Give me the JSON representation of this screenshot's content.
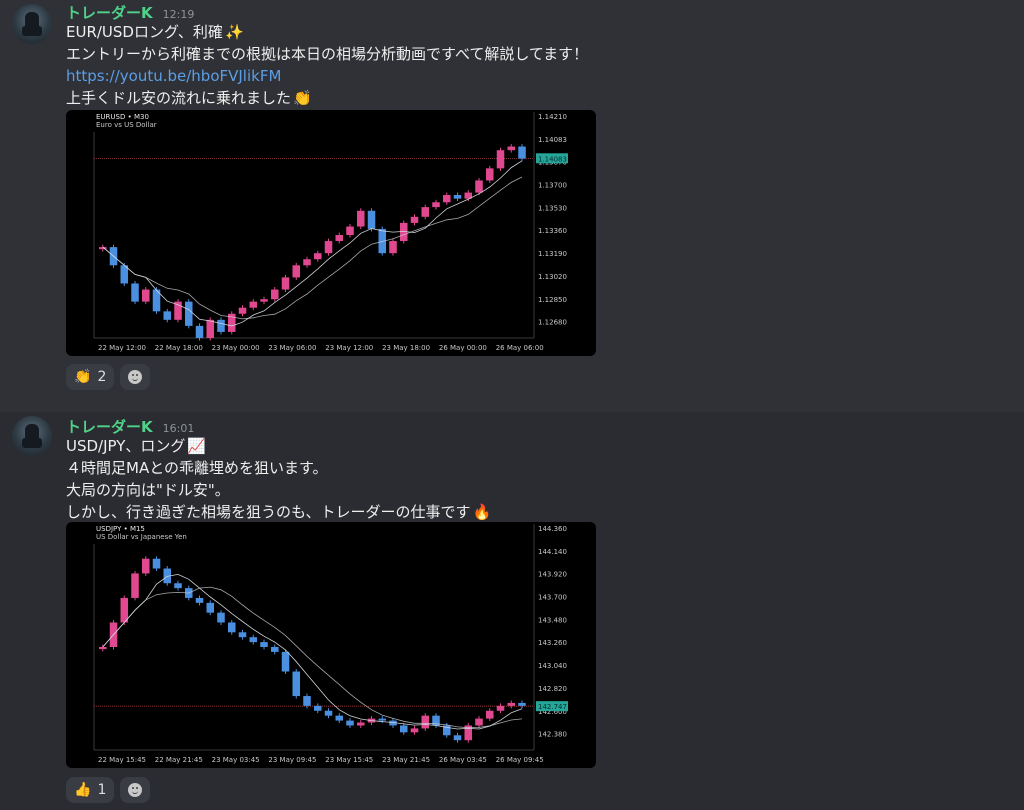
{
  "messages": [
    {
      "username": "トレーダーK",
      "time": "12:19",
      "lines": [
        "EUR/USDロング、利確",
        "エントリーから利確までの根拠は本日の相場分析動画ですべて解説してます！",
        "https://youtu.be/hboFVJlikFM",
        "上手くドル安の流れに乗れました"
      ],
      "line1_emoji": "✨",
      "line4_emoji": "👏",
      "reactions": [
        {
          "emoji": "👏",
          "count": "2"
        }
      ]
    },
    {
      "username": "トレーダーK",
      "time": "16:01",
      "lines": [
        "USD/JPY、ロング",
        "４時間足MAとの乖離埋めを狙います。",
        "大局の方向は\"ドル安\"。",
        "しかし、行き過ぎた相場を狙うのも、トレーダーの仕事です"
      ],
      "line1_emoji": "📈",
      "line4_emoji": "🔥",
      "reactions": [
        {
          "emoji": "👍",
          "count": "1"
        }
      ]
    }
  ],
  "colors": {
    "username": "#4fd28a",
    "link": "#5b9ee6",
    "bull": "#e0488f",
    "bear": "#4a8fe0",
    "ma": "#cfd3d8",
    "price_tag": "#26a69a"
  },
  "chart_data": [
    {
      "type": "candlestick",
      "symbol": "EURUSD • M30",
      "subtitle": "Euro vs US Dollar",
      "current_price": "1.14083",
      "y_ticks": [
        "1.14210",
        "1.14083",
        "1.13870",
        "1.13700",
        "1.13530",
        "1.13360",
        "1.13190",
        "1.13020",
        "1.12850",
        "1.12680"
      ],
      "x_ticks": [
        "22 May 12:00",
        "22 May 18:00",
        "23 May 00:00",
        "23 May 06:00",
        "23 May 12:00",
        "23 May 18:00",
        "26 May 00:00",
        "26 May 06:00"
      ],
      "ylim": [
        1.126,
        1.143
      ],
      "closes": [
        1.1335,
        1.132,
        1.1305,
        1.129,
        1.13,
        1.1282,
        1.1275,
        1.129,
        1.127,
        1.126,
        1.1275,
        1.1265,
        1.128,
        1.1285,
        1.129,
        1.1292,
        1.13,
        1.131,
        1.132,
        1.1325,
        1.133,
        1.134,
        1.1345,
        1.1352,
        1.1365,
        1.135,
        1.133,
        1.134,
        1.1355,
        1.136,
        1.1368,
        1.1372,
        1.1378,
        1.1375,
        1.138,
        1.139,
        1.14,
        1.1415,
        1.1418,
        1.1408
      ]
    },
    {
      "type": "candlestick",
      "symbol": "USDJPY • M15",
      "subtitle": "US Dollar vs Japanese Yen",
      "current_price": "142.747",
      "y_ticks": [
        "144.360",
        "144.140",
        "143.920",
        "143.700",
        "143.480",
        "143.260",
        "143.040",
        "142.820",
        "142.600",
        "142.380"
      ],
      "x_ticks": [
        "22 May 15:45",
        "22 May 21:45",
        "23 May 03:45",
        "23 May 09:45",
        "23 May 15:45",
        "23 May 21:45",
        "26 May 03:45",
        "26 May 09:45"
      ],
      "ylim": [
        142.3,
        144.4
      ],
      "closes": [
        143.35,
        143.6,
        143.85,
        144.1,
        144.25,
        144.15,
        144.0,
        143.95,
        143.85,
        143.8,
        143.7,
        143.6,
        143.5,
        143.45,
        143.4,
        143.35,
        143.3,
        143.1,
        142.85,
        142.75,
        142.7,
        142.65,
        142.6,
        142.55,
        142.58,
        142.62,
        142.6,
        142.55,
        142.48,
        142.52,
        142.65,
        142.55,
        142.45,
        142.4,
        142.55,
        142.62,
        142.7,
        142.75,
        142.78,
        142.75
      ]
    }
  ]
}
